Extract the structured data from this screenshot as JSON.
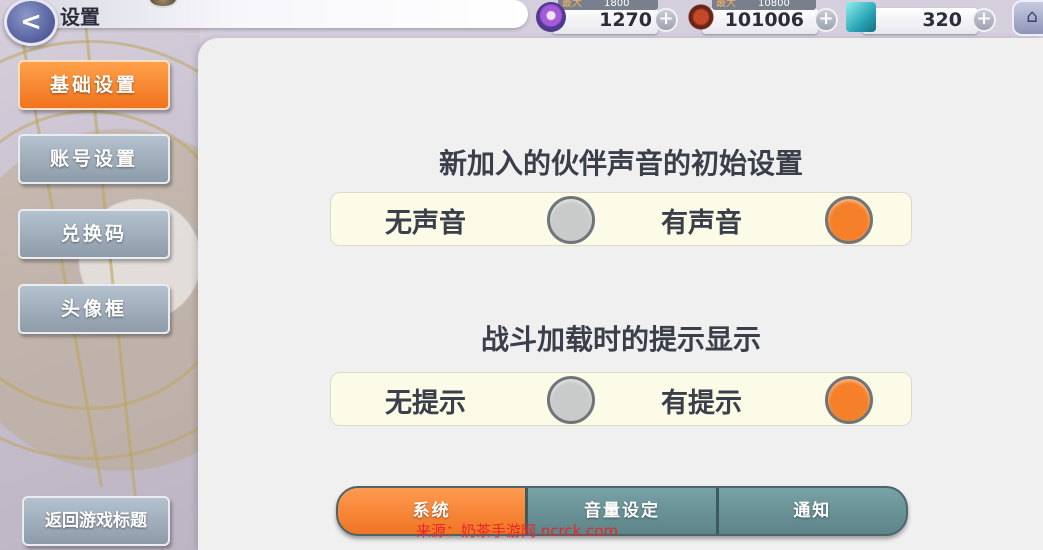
{
  "header": {
    "title": "设置",
    "currencies": [
      {
        "icon": "spirit-orb-icon",
        "max_label": "最大",
        "max_value": "1800",
        "value": "1270"
      },
      {
        "icon": "horned-beast-icon",
        "max_label": "最大",
        "max_value": "10800",
        "value": "101006"
      },
      {
        "icon": "crystal-cube-icon",
        "value": "320"
      }
    ],
    "plus": "+",
    "back_glyph": "<",
    "home_glyph": "⌂"
  },
  "sidebar": {
    "items": [
      {
        "label": "基础设置",
        "active": true
      },
      {
        "label": "账号设置",
        "active": false
      },
      {
        "label": "兑换码",
        "active": false
      },
      {
        "label": "头像框",
        "active": false
      }
    ],
    "return_label": "返回游戏标题"
  },
  "settings": [
    {
      "title": "新加入的伙伴声音的初始设置",
      "options": [
        {
          "label": "无声音",
          "selected": false
        },
        {
          "label": "有声音",
          "selected": true
        }
      ]
    },
    {
      "title": "战斗加载时的提示显示",
      "options": [
        {
          "label": "无提示",
          "selected": false
        },
        {
          "label": "有提示",
          "selected": true
        }
      ]
    }
  ],
  "tabs": [
    {
      "label": "系统",
      "active": true
    },
    {
      "label": "音量设定",
      "active": false
    },
    {
      "label": "通知",
      "active": false
    }
  ],
  "watermark": "来源：奶茶手游网 ncrck.com",
  "colors": {
    "accent_orange": "#f58029",
    "radio_off": "#c9cbcb",
    "tab_teal": "#6b9397",
    "sidebar_gray": "#9eacb9"
  }
}
